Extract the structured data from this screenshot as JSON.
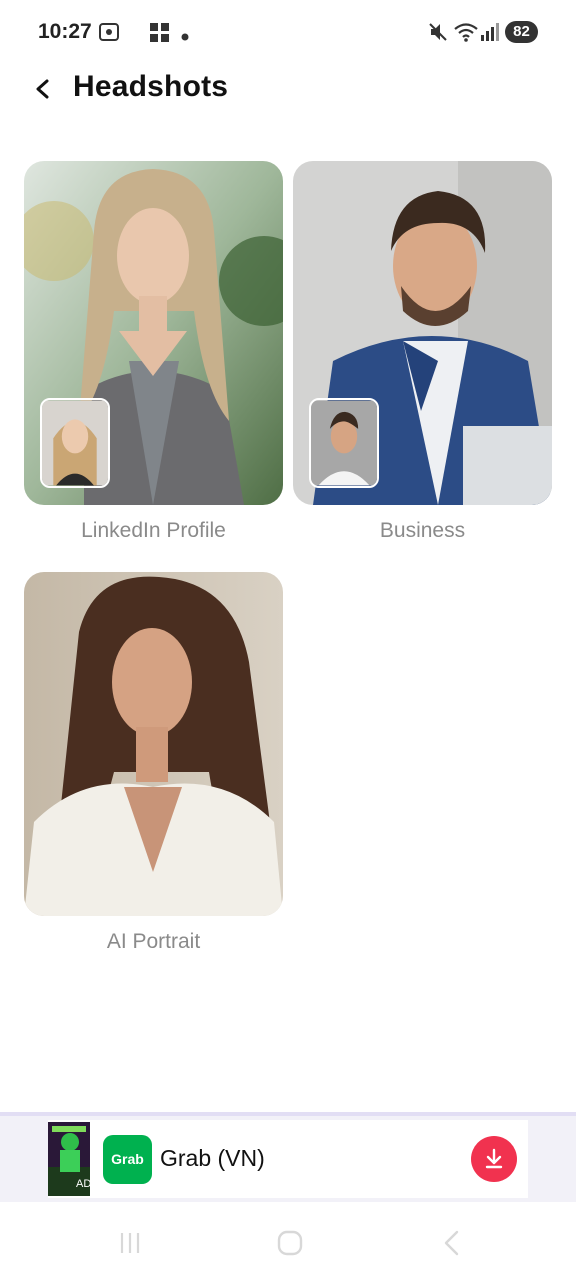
{
  "status_bar": {
    "time": "10:27",
    "battery": "82",
    "icons": [
      "screenshot-icon",
      "app-grid-icon",
      "dot-icon",
      "mute-icon",
      "wifi-icon",
      "signal-icon",
      "battery-icon"
    ]
  },
  "header": {
    "title": "Headshots",
    "back_icon": "back-arrow-icon"
  },
  "cards": [
    {
      "label": "LinkedIn Profile",
      "has_thumbnail": true
    },
    {
      "label": "Business",
      "has_thumbnail": true
    },
    {
      "label": "AI Portrait",
      "has_thumbnail": false
    }
  ],
  "ad": {
    "title": "Grab (VN)",
    "logo_text": "Grab",
    "tag": "AD",
    "download_icon": "download-icon",
    "accent_color": "#f1324f",
    "brand_color": "#00b14f"
  },
  "nav_bar": {
    "icons": [
      "recents-icon",
      "home-icon",
      "back-icon"
    ]
  }
}
